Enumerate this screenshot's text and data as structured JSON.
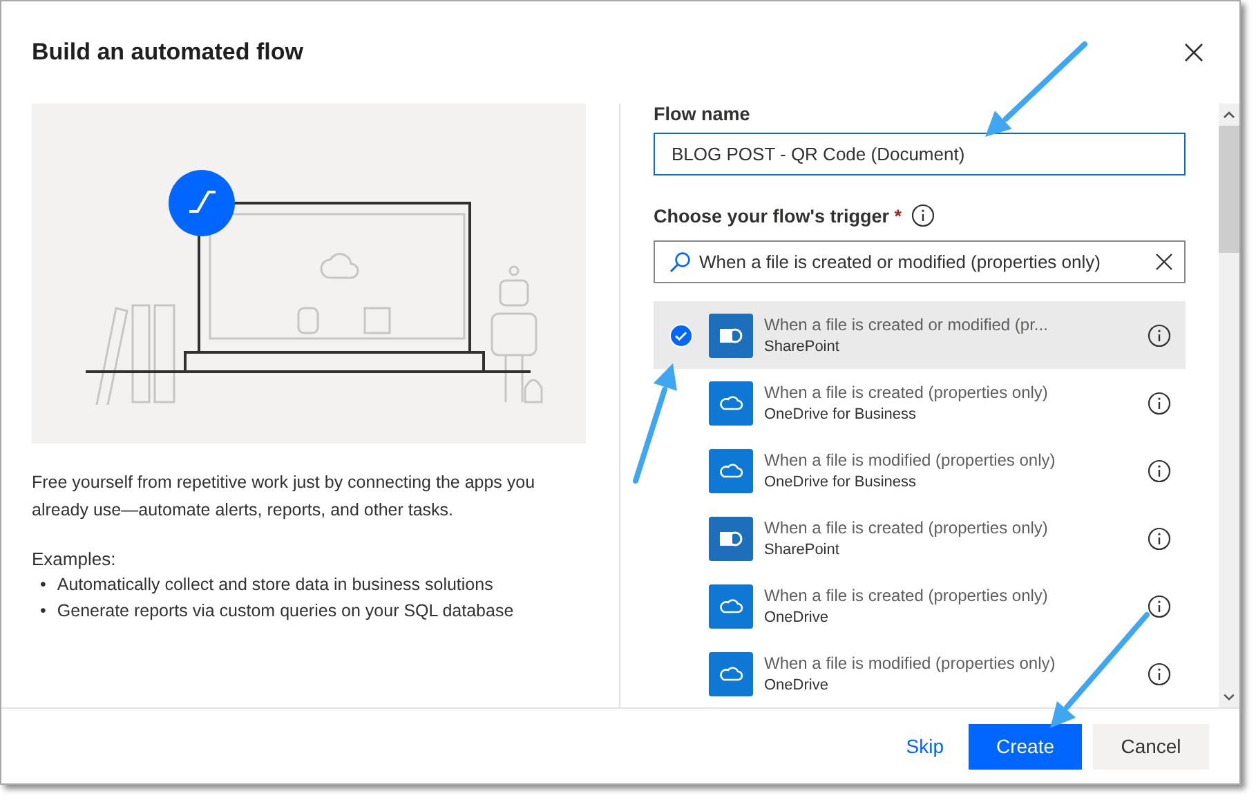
{
  "dialog": {
    "title": "Build an automated flow"
  },
  "description": "Free yourself from repetitive work just by connecting the apps you already use—automate alerts, reports, and other tasks.",
  "examples": {
    "heading": "Examples:",
    "items": [
      {
        "bullet": "•",
        "text": "Automatically collect and store data in business solutions"
      },
      {
        "bullet": "•",
        "text": "Generate reports via custom queries on your SQL database"
      }
    ]
  },
  "flow_name": {
    "label": "Flow name",
    "value": "BLOG POST - QR Code (Document)"
  },
  "trigger": {
    "label": "Choose your flow's trigger",
    "required_mark": "*",
    "search_value": "When a file is created or modified (properties only)"
  },
  "triggers": [
    {
      "title": "When a file is created or modified (pr...",
      "connector": "SharePoint",
      "kind": "sharepoint",
      "selected": true
    },
    {
      "title": "When a file is created (properties only)",
      "connector": "OneDrive for Business",
      "kind": "onedrive",
      "selected": false
    },
    {
      "title": "When a file is modified (properties only)",
      "connector": "OneDrive for Business",
      "kind": "onedrive",
      "selected": false
    },
    {
      "title": "When a file is created (properties only)",
      "connector": "SharePoint",
      "kind": "sharepoint",
      "selected": false
    },
    {
      "title": "When a file is created (properties only)",
      "connector": "OneDrive",
      "kind": "onedrive",
      "selected": false
    },
    {
      "title": "When a file is modified (properties only)",
      "connector": "OneDrive",
      "kind": "onedrive",
      "selected": false
    }
  ],
  "buttons": [
    {
      "label": "Skip",
      "kind": "link"
    },
    {
      "label": "Create",
      "kind": "primary"
    },
    {
      "label": "Cancel",
      "kind": "default"
    }
  ]
}
